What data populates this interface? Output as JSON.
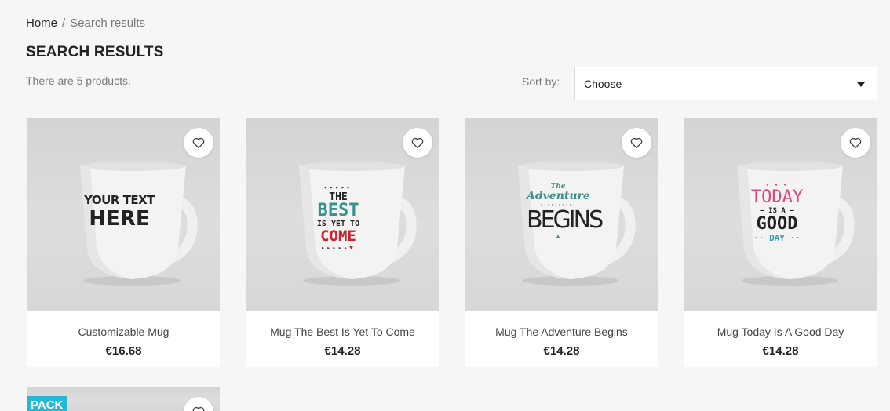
{
  "breadcrumb": {
    "home": "Home",
    "separator": "/",
    "current": "Search results"
  },
  "page_title": "SEARCH RESULTS",
  "product_count": "There are 5 products.",
  "sort": {
    "label": "Sort by:",
    "selected": "Choose"
  },
  "products": [
    {
      "name": "Customizable Mug",
      "price": "€16.68",
      "mug_lines": [
        "YOUR TEXT",
        "HERE"
      ]
    },
    {
      "name": "Mug The Best Is Yet To Come",
      "price": "€14.28",
      "mug_lines": [
        "THE",
        "BEST",
        "IS YET TO",
        "COME"
      ]
    },
    {
      "name": "Mug The Adventure Begins",
      "price": "€14.28",
      "mug_lines": [
        "The",
        "Adventure",
        "BEGINS"
      ]
    },
    {
      "name": "Mug Today Is A Good Day",
      "price": "€14.28",
      "mug_lines": [
        "TODAY",
        "IS A",
        "GOOD",
        "DAY"
      ]
    },
    {
      "badge": "PACK"
    }
  ],
  "colors": {
    "pack_badge": "#24b9d7",
    "background": "#f6f6f6",
    "best_teal": "#3a8f8f",
    "best_red": "#c8242f",
    "today_pink": "#e0467c"
  },
  "icons": {
    "wishlist": "heart-outline-icon",
    "dropdown": "caret-down-icon"
  }
}
